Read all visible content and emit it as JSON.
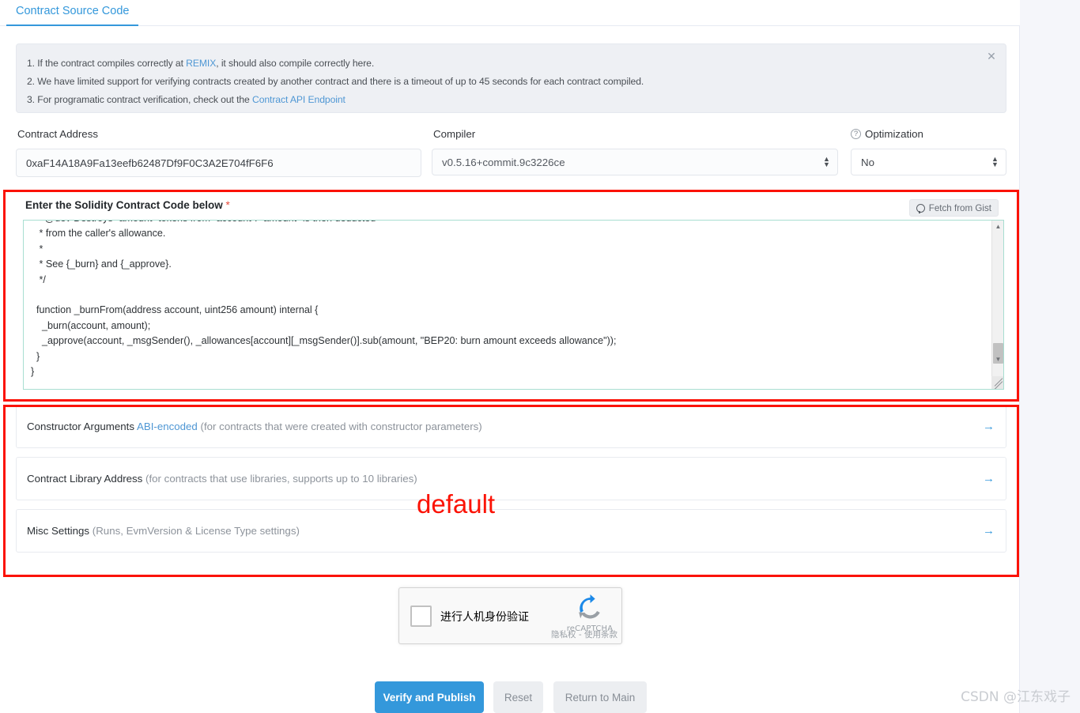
{
  "tab": {
    "label": "Contract Source Code"
  },
  "alert": {
    "line1_pre": "1. If the contract compiles correctly at ",
    "line1_link": "REMIX",
    "line1_post": ", it should also compile correctly here.",
    "line2": "2. We have limited support for verifying contracts created by another contract and there is a timeout of up to 45 seconds for each contract compiled.",
    "line3_pre": "3. For programatic contract verification, check out the ",
    "line3_link": "Contract API Endpoint",
    "close_icon": "close-icon",
    "close_glyph": "✕"
  },
  "form": {
    "contract_address": {
      "label": "Contract Address",
      "value": "0xaF14A18A9Fa13eefb62487Df9F0C3A2E704fF6F6"
    },
    "compiler": {
      "label": "Compiler",
      "value": "v0.5.16+commit.9c3226ce"
    },
    "optimization": {
      "label": "Optimization",
      "value": "No",
      "help_icon": "question-mark-icon",
      "help_glyph": "?"
    },
    "select_arrow_glyph": "▲\n▼"
  },
  "code_section": {
    "title": "Enter the Solidity Contract Code below",
    "required_marker": "*",
    "gist_button": {
      "label": "Fetch from Gist",
      "icon": "github-icon"
    },
    "code": "     @dev Destroys `amount` tokens from `account`. `amount` is then deducted\n   * from the caller's allowance.\n   *\n   * See {_burn} and {_approve}.\n   */\n\n  function _burnFrom(address account, uint256 amount) internal {\n    _burn(account, amount);\n    _approve(account, _msgSender(), _allowances[account][_msgSender()].sub(amount, \"BEP20: burn amount exceeds allowance\"));\n  }\n}",
    "scrollbar": {
      "up_glyph": "▲",
      "down_glyph": "▼"
    }
  },
  "collapse_rows": [
    {
      "title": "Constructor Arguments ",
      "link": "ABI-encoded",
      "hint": " (for contracts that were created with constructor parameters)",
      "arrow_glyph": "→",
      "name": "constructor-arguments"
    },
    {
      "title": "Contract Library Address",
      "link": "",
      "hint": " (for contracts that use libraries, supports up to 10 libraries)",
      "arrow_glyph": "→",
      "name": "contract-library-address"
    },
    {
      "title": "Misc Settings",
      "link": "",
      "hint": " (Runs, EvmVersion & License Type settings)",
      "arrow_glyph": "→",
      "name": "misc-settings"
    }
  ],
  "recaptcha": {
    "label": "进行人机身份验证",
    "brand": "reCAPTCHA",
    "terms": "隐私权 - 使用条款",
    "checkbox_name": "recaptcha-checkbox"
  },
  "buttons": {
    "verify": "Verify and Publish",
    "reset": "Reset",
    "return": "Return to Main"
  },
  "annotations": {
    "default_text": "default"
  },
  "watermark": "CSDN @江东戏子",
  "colors": {
    "accent": "#3498db",
    "annotation": "#fb1205",
    "alert_bg": "#eef0f4",
    "muted_text": "#8d939b"
  }
}
